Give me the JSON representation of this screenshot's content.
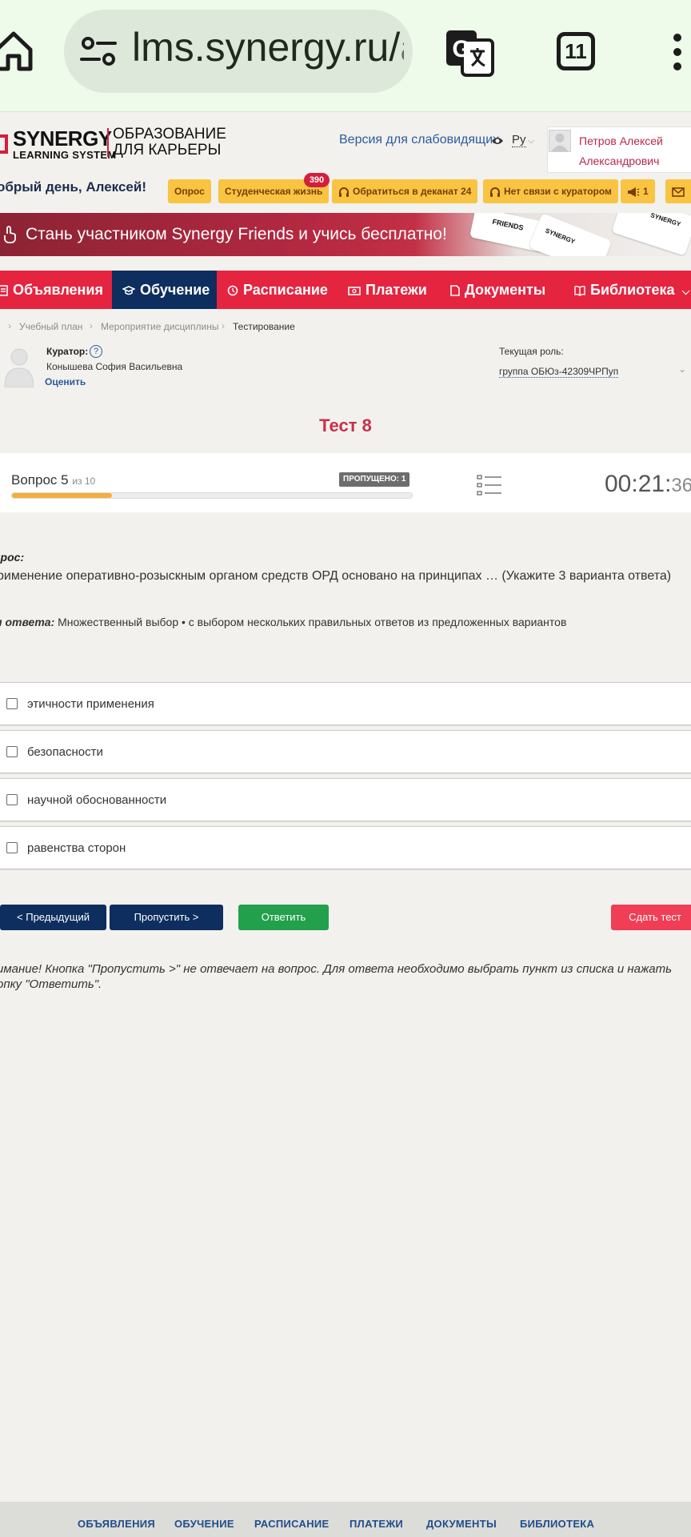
{
  "browser": {
    "url_main": "lms.synergy.ru/",
    "url_dim": "as",
    "tab_count": "11"
  },
  "header": {
    "logo_big": "SYNERGY",
    "logo_small": "LEARNING SYSTEM",
    "tagline_1": "ОБРАЗОВАНИЕ",
    "tagline_2": "ДЛЯ КАРЬЕРЫ",
    "a11y_link": "Версия для слабовидящих",
    "language": "Ру",
    "user_name_1": "Петров Алексей",
    "user_name_2": "Александрович",
    "greeting": "обрый день, Алексей!",
    "chips": {
      "survey": "Опрос",
      "student_life": "Студенческая жизнь",
      "student_life_badge": "390",
      "dean": "Обратиться в деканат 24",
      "curator": "Нет связи с куратором",
      "announce_count": "1"
    }
  },
  "banner": {
    "text": "Стань участником Synergy Friends и учись бесплатно!",
    "card_1": "FRIENDS",
    "card_2": "SYNERGY",
    "card_3": "SYNERGY"
  },
  "nav": {
    "announcements": "Объявления",
    "learning": "Обучение",
    "schedule": "Расписание",
    "payments": "Платежи",
    "documents": "Документы",
    "library": "Библиотека"
  },
  "breadcrumbs": [
    "Учебный план",
    "Мероприятие дисциплины",
    "Тестирование"
  ],
  "curator": {
    "label": "Куратор:",
    "help": "?",
    "name": "Конышева София Васильевна",
    "rate": "Оценить",
    "role_label": "Текущая роль:",
    "role_value": "группа ОБЮз-42309ЧРПуп"
  },
  "test": {
    "title": "Тест 8",
    "question_label": "Вопрос 5",
    "question_of": "из 10",
    "skipped": "ПРОПУЩЕНО: 1",
    "progress": 0.25,
    "timer_main": "00:21:",
    "timer_sec": "36"
  },
  "question": {
    "heading": "прос:",
    "text": "рименение оперативно-розыскным органом средств ОРД основано на принципах … (Укажите 3 варианта ответа)",
    "type_label": "п ответа:",
    "type_value": "Множественный выбор • с выбором нескольких правильных ответов из предложенных вариантов",
    "options": [
      "этичности применения",
      "безопасности",
      "научной обоснованности",
      "равенства сторон"
    ]
  },
  "buttons": {
    "prev": "< Предыдущий",
    "skip": "Пропустить >",
    "answer": "Ответить",
    "submit": "Сдать тест"
  },
  "warning": "имание! Кнопка \"Пропустить >\" не отвечает на вопрос. Для ответа необходимо выбрать пункт из списка и нажать опку \"Ответить\".",
  "footer": [
    "ОБЪЯВЛЕНИЯ",
    "ОБУЧЕНИЕ",
    "РАСПИСАНИЕ",
    "ПЛАТЕЖИ",
    "ДОКУМЕНТЫ",
    "БИБЛИОТЕКА"
  ],
  "colors": {
    "nav_red": "#e5243f",
    "nav_active": "#0d2e5e",
    "chip_yellow": "#f8c442",
    "title_red": "#c8304b",
    "answer_green": "#22a04c",
    "submit_red": "#ef3e55"
  }
}
